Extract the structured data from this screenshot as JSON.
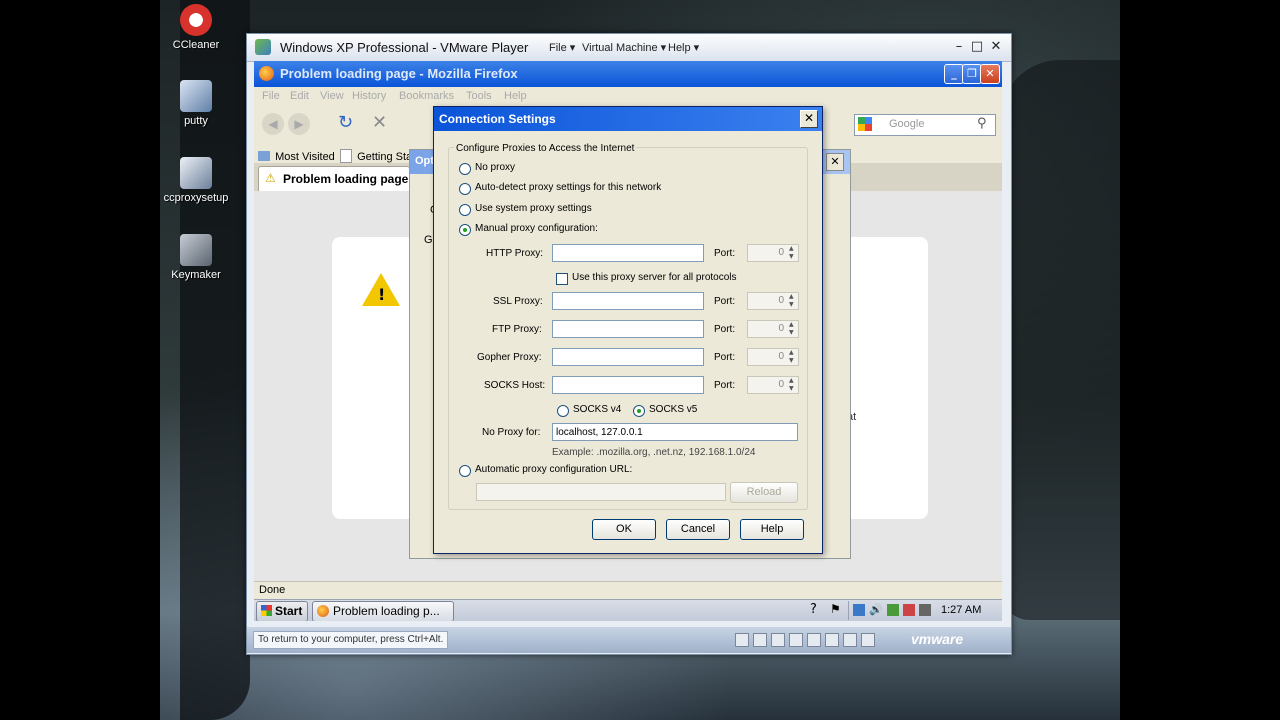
{
  "desktop": {
    "icons": [
      {
        "label": "CCleaner"
      },
      {
        "label": "putty"
      },
      {
        "label": "ccproxysetup"
      },
      {
        "label": "Keymaker"
      }
    ]
  },
  "vmware": {
    "title": "Windows XP Professional - VMware Player",
    "menu": [
      "File",
      "Virtual Machine",
      "Help"
    ],
    "status_hint": "To return to your computer, press Ctrl+Alt.",
    "brand": "vmware"
  },
  "firefox": {
    "title": "Problem loading page - Mozilla Firefox",
    "menus": [
      "File",
      "Edit",
      "View",
      "History",
      "Bookmarks",
      "Tools",
      "Help"
    ],
    "search_placeholder": "Google",
    "bookmarks": [
      "Most Visited",
      "Getting Sta"
    ],
    "tab_label": "Problem loading page",
    "status": "Done",
    "partial_text_right": "at",
    "dialog_fragments": {
      "options_title": "Opt",
      "label_c": "C",
      "label_ge": "Ge"
    }
  },
  "taskbar": {
    "start": "Start",
    "task": "Problem loading p...",
    "clock": "1:27 AM"
  },
  "dialog": {
    "title": "Connection Settings",
    "group_label": "Configure Proxies to Access the Internet",
    "options": [
      {
        "label": "No proxy",
        "selected": false
      },
      {
        "label": "Auto-detect proxy settings for this network",
        "selected": false
      },
      {
        "label": "Use system proxy settings",
        "selected": false
      },
      {
        "label": "Manual proxy configuration:",
        "selected": true
      }
    ],
    "http_label": "HTTP Proxy:",
    "http_value": "",
    "port_label": "Port:",
    "http_port": "0",
    "same_proxy_label": "Use this proxy server for all protocols",
    "ssl_label": "SSL Proxy:",
    "ssl_port": "0",
    "ftp_label": "FTP Proxy:",
    "ftp_port": "0",
    "gopher_label": "Gopher Proxy:",
    "gopher_port": "0",
    "socks_label": "SOCKS Host:",
    "socks_port": "0",
    "socks_v4": "SOCKS v4",
    "socks_v5": "SOCKS v5",
    "socks_version": "v5",
    "no_proxy_label": "No Proxy for:",
    "no_proxy_value": "localhost, 127.0.0.1",
    "example": "Example: .mozilla.org, .net.nz, 192.168.1.0/24",
    "auto_url_label": "Automatic proxy configuration URL:",
    "auto_url_value": "",
    "reload_label": "Reload",
    "ok": "OK",
    "cancel": "Cancel",
    "help": "Help"
  }
}
